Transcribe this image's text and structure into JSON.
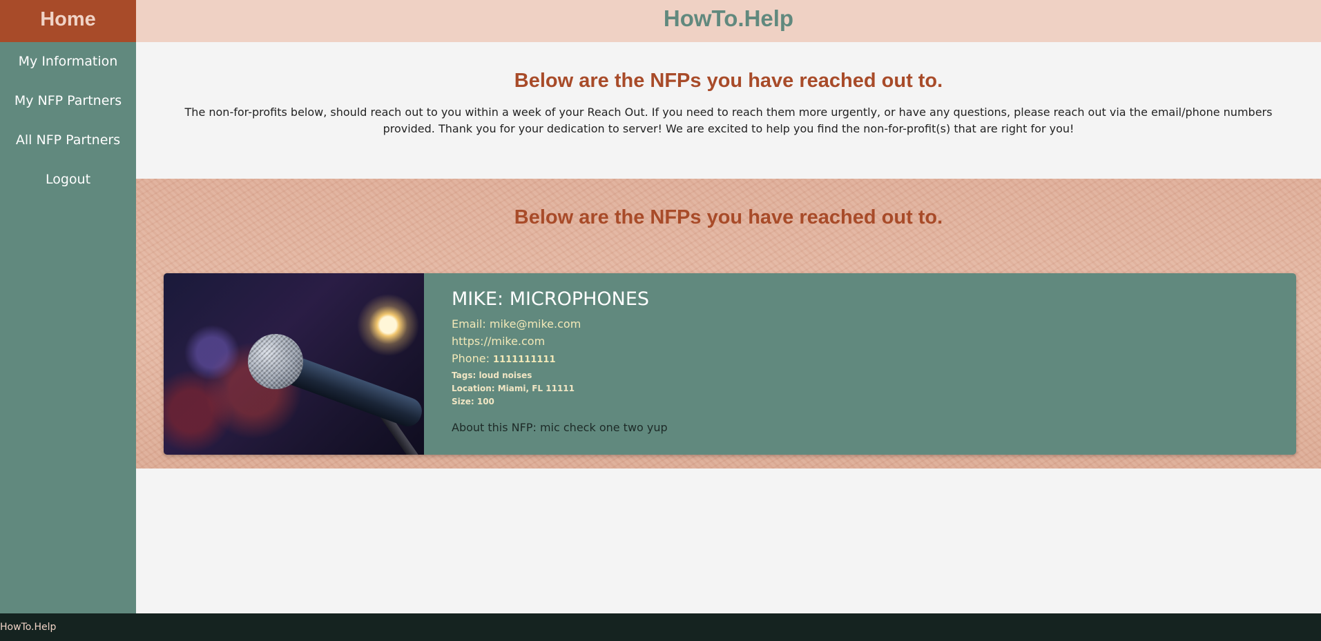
{
  "sidebar": {
    "home_label": "Home",
    "items": [
      {
        "label": "My Information"
      },
      {
        "label": "My NFP Partners"
      },
      {
        "label": "All NFP Partners"
      },
      {
        "label": "Logout"
      }
    ]
  },
  "header": {
    "brand": "HowTo.Help"
  },
  "intro": {
    "heading": "Below are the NFPs you have reached out to.",
    "text": "The non-for-profits below, should reach out to you within a week of your Reach Out. If you need to reach them more urgently, or have any questions, please reach out via the email/phone numbers provided. Thank you for your dedication to server! We are excited to help you find the non-for-profit(s) that are right for you!"
  },
  "partners": {
    "heading": "Below are the NFPs you have reached out to.",
    "cards": [
      {
        "title": "MIKE: MICROPHONES",
        "email_label": "Email: ",
        "email": "mike@mike.com",
        "website": "https://mike.com",
        "phone_label": "Phone: ",
        "phone": "1111111111",
        "tags": "Tags: loud noises",
        "location": "Location: Miami, FL 11111",
        "size": "Size: 100",
        "about": "About this NFP: mic check one two yup",
        "image": "microphone-photo"
      }
    ]
  },
  "footer": {
    "text": "HowTo.Help"
  },
  "colors": {
    "sidebar": "#61897e",
    "home": "#a84b29",
    "header": "#efd1c4",
    "accent": "#a84b29",
    "footer": "#152320"
  }
}
